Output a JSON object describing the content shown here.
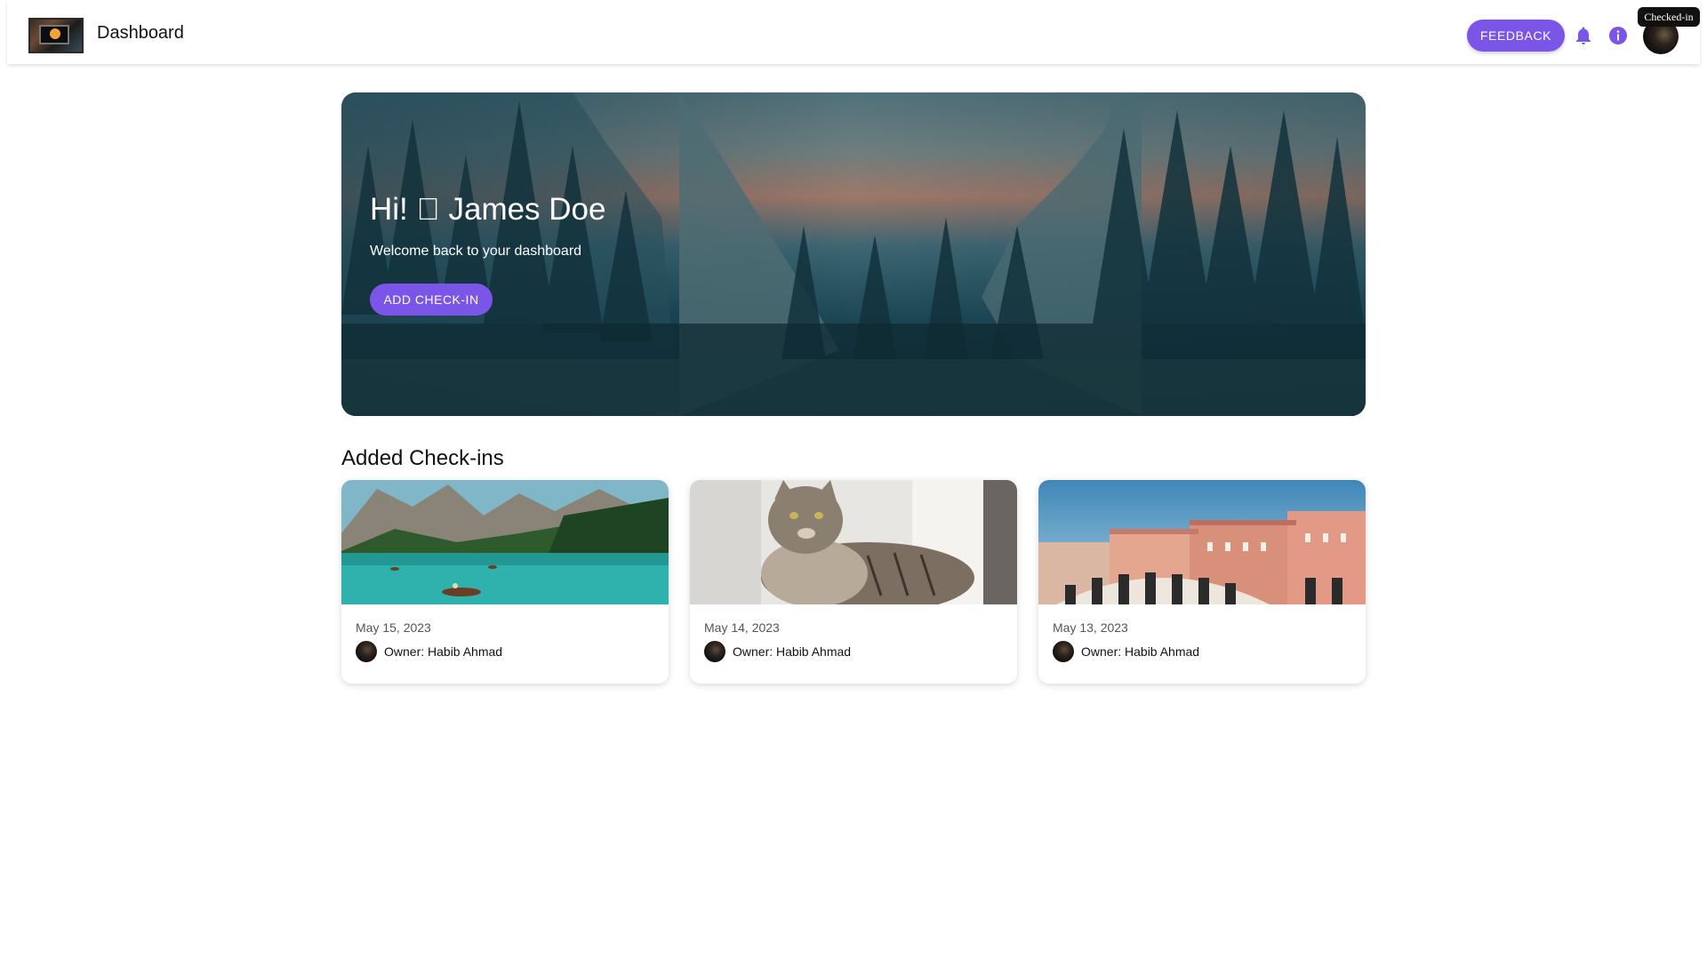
{
  "header": {
    "title": "Dashboard",
    "feedback_label": "FEEDBACK",
    "tooltip": "Checked-in"
  },
  "hero": {
    "greeting": "Hi! \u0000 James Doe",
    "subtitle": "Welcome back to your dashboard",
    "button_label": "ADD CHECK-IN"
  },
  "checkins": {
    "title": "Added Check-ins",
    "items": [
      {
        "date": "May 15, 2023",
        "owner": "Owner: Habib Ahmad",
        "image": "lake-mountains"
      },
      {
        "date": "May 14, 2023",
        "owner": "Owner: Habib Ahmad",
        "image": "tabby-cat"
      },
      {
        "date": "May 13, 2023",
        "owner": "Owner: Habib Ahmad",
        "image": "venice-bridge"
      }
    ]
  },
  "colors": {
    "accent": "#7b54e8"
  },
  "icons": [
    "bell-icon",
    "info-icon"
  ]
}
